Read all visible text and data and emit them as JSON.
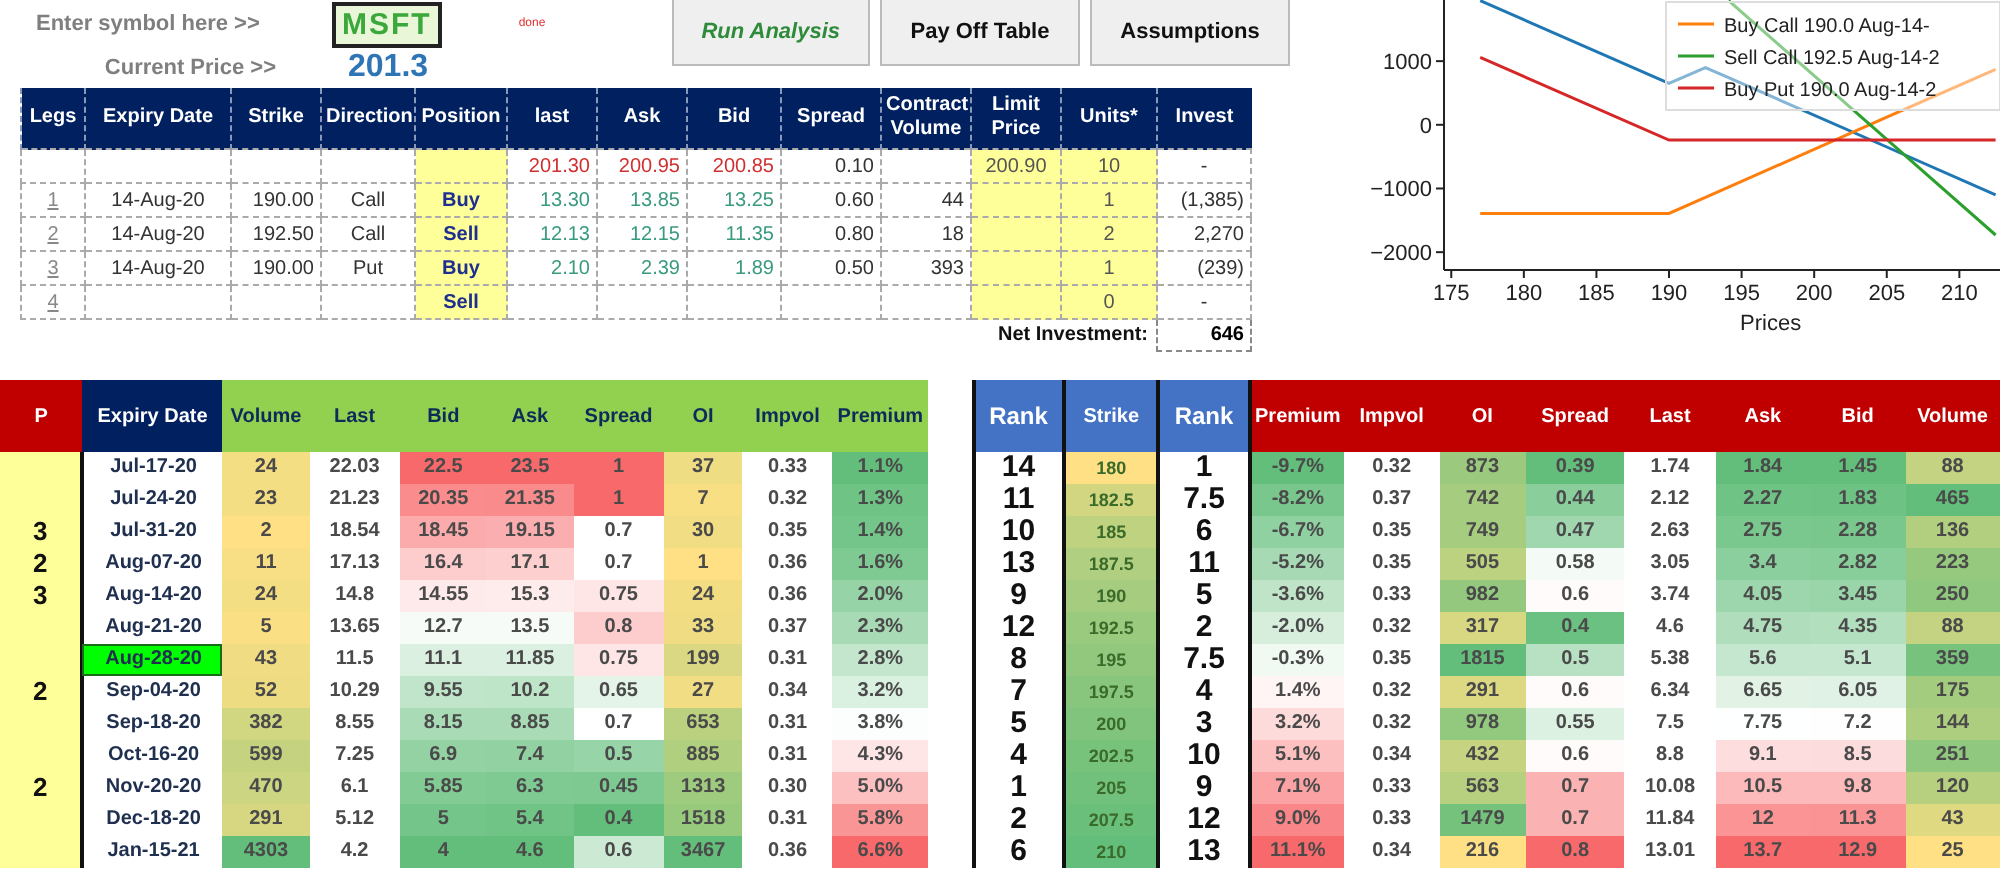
{
  "symbol_bar": {
    "symbol_label": "Enter symbol here >>",
    "symbol": "MSFT",
    "status": "done",
    "price_label": "Current Price >>",
    "price": "201.3"
  },
  "buttons": [
    {
      "label": "Run Analysis",
      "kind": "primary"
    },
    {
      "label": "Pay Off Table",
      "kind": "plain"
    },
    {
      "label": "Assumptions",
      "kind": "plain"
    }
  ],
  "legs_table": {
    "columns": [
      {
        "label": "Legs",
        "kind": "text"
      },
      {
        "label": "Expiry Date",
        "kind": "text"
      },
      {
        "label": "Strike",
        "kind": "text"
      },
      {
        "label": "Direction",
        "kind": "text"
      },
      {
        "label": "Position",
        "kind": "input"
      },
      {
        "label": "last",
        "kind": "text"
      },
      {
        "label": "Ask",
        "kind": "text"
      },
      {
        "label": "Bid",
        "kind": "text"
      },
      {
        "label": "Spread",
        "kind": "text"
      },
      {
        "label": "Contract Volume",
        "kind": "text"
      },
      {
        "label": "Limit Price",
        "kind": "input"
      },
      {
        "label": "Units*",
        "kind": "input"
      },
      {
        "label": "Invest",
        "kind": "text"
      }
    ],
    "rows": [
      {
        "kind": "underlying",
        "cells": [
          "",
          "",
          "",
          "",
          "",
          "201.30",
          "200.95",
          "200.85",
          "0.10",
          "",
          "200.90",
          "10",
          "-"
        ]
      },
      {
        "kind": "leg",
        "cells": [
          "1",
          "14-Aug-20",
          "190.00",
          "Call",
          "Buy",
          "13.30",
          "13.85",
          "13.25",
          "0.60",
          "44",
          "",
          "1",
          "(1,385)"
        ]
      },
      {
        "kind": "leg",
        "cells": [
          "2",
          "14-Aug-20",
          "192.50",
          "Call",
          "Sell",
          "12.13",
          "12.15",
          "11.35",
          "0.80",
          "18",
          "",
          "2",
          "2,270"
        ]
      },
      {
        "kind": "leg",
        "cells": [
          "3",
          "14-Aug-20",
          "190.00",
          "Put",
          "Buy",
          "2.10",
          "2.39",
          "1.89",
          "0.50",
          "393",
          "",
          "1",
          "(239)"
        ]
      },
      {
        "kind": "leg",
        "cells": [
          "4",
          "",
          "",
          "",
          "Sell",
          "",
          "",
          "",
          "",
          "",
          "",
          "0",
          "-"
        ]
      }
    ],
    "net_label": "Net Investment:",
    "net_value": "646"
  },
  "payoff_chart": {
    "chart_data": {
      "type": "line",
      "xlabel": "Prices",
      "x": [
        177,
        190,
        192.5,
        194.1,
        205,
        212.5
      ],
      "series": [
        {
          "color": "#1f77b4",
          "values": [
            1950,
            650,
            900,
            740,
            -350,
            -1100
          ]
        },
        {
          "name": "Buy Call 190.0 Aug-14-",
          "color": "#ff7f0e",
          "values": [
            -1390,
            -1390,
            -1140,
            -980,
            120,
            870
          ]
        },
        {
          "name": "Sell Call 192.5 Aug-14-2",
          "color": "#2ca02c",
          "values": [
            null,
            null,
            null,
            1950,
            -230,
            -1730
          ]
        },
        {
          "name": "Buy Put 190.0 Aug-14-2",
          "color": "#d62728",
          "values": [
            1060,
            -240,
            -240,
            -240,
            -240,
            -240
          ]
        }
      ],
      "legend": "upper right",
      "xlim": [
        174.5,
        212.8
      ],
      "ylim": [
        -2280,
        1960
      ],
      "xticks": [
        175,
        180,
        185,
        190,
        195,
        200,
        205,
        210
      ],
      "yticks": [
        {
          "value": -2000,
          "label": "−2000"
        },
        {
          "value": -1000,
          "label": "−1000"
        },
        {
          "value": 0,
          "label": "0"
        },
        {
          "value": 1000,
          "label": "1000"
        }
      ]
    }
  },
  "options_table": {
    "columns": [
      {
        "label": "P",
        "kind": "flag",
        "color": "#c00000"
      },
      {
        "label": "Expiry Date",
        "kind": "date",
        "color": "#002060"
      },
      {
        "label": "Volume",
        "kind": "yellowgreen",
        "color": "#92d050"
      },
      {
        "label": "Last",
        "kind": "plain",
        "color": "#92d050"
      },
      {
        "label": "Bid",
        "kind": "greenred",
        "color": "#92d050"
      },
      {
        "label": "Ask",
        "kind": "greenred",
        "color": "#92d050"
      },
      {
        "label": "Spread",
        "kind": "greenred",
        "color": "#92d050"
      },
      {
        "label": "OI",
        "kind": "yellowgreen",
        "color": "#92d050"
      },
      {
        "label": "Impvol",
        "kind": "plain",
        "color": "#92d050"
      },
      {
        "label": "Premium",
        "kind": "greenred",
        "color": "#92d050"
      },
      {
        "label": "Rank",
        "kind": "rank",
        "color": "#4472c4"
      },
      {
        "label": "Strike",
        "kind": "strike",
        "color": "#4472c4"
      },
      {
        "label": "Rank",
        "kind": "rank",
        "color": "#4472c4"
      },
      {
        "label": "Premium",
        "kind": "greenred",
        "color": "#c00000"
      },
      {
        "label": "Impvol",
        "kind": "plain",
        "color": "#c00000"
      },
      {
        "label": "OI",
        "kind": "yellowgreen",
        "color": "#c00000"
      },
      {
        "label": "Spread",
        "kind": "greenred",
        "color": "#c00000"
      },
      {
        "label": "Last",
        "kind": "plain",
        "color": "#c00000"
      },
      {
        "label": "Ask",
        "kind": "greenred",
        "color": "#c00000"
      },
      {
        "label": "Bid",
        "kind": "greenred",
        "color": "#c00000"
      },
      {
        "label": "Volume",
        "kind": "yellowgreen",
        "color": "#c00000"
      }
    ],
    "rows": [
      {
        "selected": false,
        "cells": [
          "",
          "Jul-17-20",
          "24",
          "22.03",
          "22.5",
          "23.5",
          "1",
          "37",
          "0.33",
          "1.1%",
          "14",
          "180",
          "1",
          "-9.7%",
          "0.32",
          "873",
          "0.39",
          "1.74",
          "1.84",
          "1.45",
          "88"
        ]
      },
      {
        "selected": false,
        "cells": [
          "",
          "Jul-24-20",
          "23",
          "21.23",
          "20.35",
          "21.35",
          "1",
          "7",
          "0.32",
          "1.3%",
          "11",
          "182.5",
          "7.5",
          "-8.2%",
          "0.37",
          "742",
          "0.44",
          "2.12",
          "2.27",
          "1.83",
          "465"
        ]
      },
      {
        "selected": false,
        "cells": [
          "3",
          "Jul-31-20",
          "2",
          "18.54",
          "18.45",
          "19.15",
          "0.7",
          "30",
          "0.35",
          "1.4%",
          "10",
          "185",
          "6",
          "-6.7%",
          "0.35",
          "749",
          "0.47",
          "2.63",
          "2.75",
          "2.28",
          "136"
        ]
      },
      {
        "selected": false,
        "cells": [
          "2",
          "Aug-07-20",
          "11",
          "17.13",
          "16.4",
          "17.1",
          "0.7",
          "1",
          "0.36",
          "1.6%",
          "13",
          "187.5",
          "11",
          "-5.2%",
          "0.35",
          "505",
          "0.58",
          "3.05",
          "3.4",
          "2.82",
          "223"
        ]
      },
      {
        "selected": false,
        "cells": [
          "3",
          "Aug-14-20",
          "24",
          "14.8",
          "14.55",
          "15.3",
          "0.75",
          "24",
          "0.36",
          "2.0%",
          "9",
          "190",
          "5",
          "-3.6%",
          "0.33",
          "982",
          "0.6",
          "3.74",
          "4.05",
          "3.45",
          "250"
        ]
      },
      {
        "selected": false,
        "cells": [
          "",
          "Aug-21-20",
          "5",
          "13.65",
          "12.7",
          "13.5",
          "0.8",
          "33",
          "0.37",
          "2.3%",
          "12",
          "192.5",
          "2",
          "-2.0%",
          "0.32",
          "317",
          "0.4",
          "4.6",
          "4.75",
          "4.35",
          "88"
        ]
      },
      {
        "selected": true,
        "cells": [
          "",
          "Aug-28-20",
          "43",
          "11.5",
          "11.1",
          "11.85",
          "0.75",
          "199",
          "0.31",
          "2.8%",
          "8",
          "195",
          "7.5",
          "-0.3%",
          "0.35",
          "1815",
          "0.5",
          "5.38",
          "5.6",
          "5.1",
          "359"
        ]
      },
      {
        "selected": false,
        "cells": [
          "2",
          "Sep-04-20",
          "52",
          "10.29",
          "9.55",
          "10.2",
          "0.65",
          "27",
          "0.34",
          "3.2%",
          "7",
          "197.5",
          "4",
          "1.4%",
          "0.32",
          "291",
          "0.6",
          "6.34",
          "6.65",
          "6.05",
          "175"
        ]
      },
      {
        "selected": false,
        "cells": [
          "",
          "Sep-18-20",
          "382",
          "8.55",
          "8.15",
          "8.85",
          "0.7",
          "653",
          "0.31",
          "3.8%",
          "5",
          "200",
          "3",
          "3.2%",
          "0.32",
          "978",
          "0.55",
          "7.5",
          "7.75",
          "7.2",
          "144"
        ]
      },
      {
        "selected": false,
        "cells": [
          "",
          "Oct-16-20",
          "599",
          "7.25",
          "6.9",
          "7.4",
          "0.5",
          "885",
          "0.31",
          "4.3%",
          "4",
          "202.5",
          "10",
          "5.1%",
          "0.34",
          "432",
          "0.6",
          "8.8",
          "9.1",
          "8.5",
          "251"
        ]
      },
      {
        "selected": false,
        "cells": [
          "2",
          "Nov-20-20",
          "470",
          "6.1",
          "5.85",
          "6.3",
          "0.45",
          "1313",
          "0.30",
          "5.0%",
          "1",
          "205",
          "9",
          "7.1%",
          "0.33",
          "563",
          "0.7",
          "10.08",
          "10.5",
          "9.8",
          "120"
        ]
      },
      {
        "selected": false,
        "cells": [
          "",
          "Dec-18-20",
          "291",
          "5.12",
          "5",
          "5.4",
          "0.4",
          "1518",
          "0.31",
          "5.8%",
          "2",
          "207.5",
          "12",
          "9.0%",
          "0.33",
          "1479",
          "0.7",
          "11.84",
          "12",
          "11.3",
          "43"
        ]
      },
      {
        "selected": false,
        "cells": [
          "",
          "Jan-15-21",
          "4303",
          "4.2",
          "4",
          "4.6",
          "0.6",
          "3467",
          "0.36",
          "6.6%",
          "6",
          "210",
          "13",
          "11.1%",
          "0.34",
          "216",
          "0.8",
          "13.01",
          "13.7",
          "12.9",
          "25"
        ]
      }
    ]
  }
}
